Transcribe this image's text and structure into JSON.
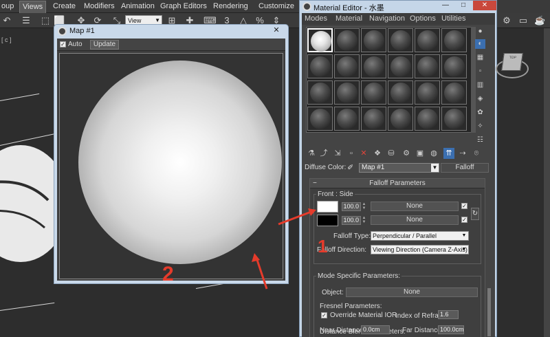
{
  "app": {
    "menu": [
      "oup",
      "Views",
      "Create",
      "Modifiers",
      "Animation",
      "Graph Editors",
      "Rendering",
      "Customize"
    ],
    "view_dropdown": "View",
    "toolbar_number": "3"
  },
  "viewport": {
    "label": "[ c ]"
  },
  "map_window": {
    "title": "Map #1",
    "close": "✕",
    "auto_label": "Auto",
    "auto_checked": "✓",
    "update_label": "Update"
  },
  "material_editor": {
    "title": "Material Editor - 水墨",
    "menus": [
      "Modes",
      "Material",
      "Navigation",
      "Options",
      "Utilities"
    ],
    "diffuse_label": "Diffuse Color:",
    "map_name": "Map #1",
    "map_type": "Falloff",
    "falloff": {
      "header": "Falloff Parameters",
      "front_side_label": "Front : Side",
      "row1": {
        "amount": "100.0",
        "map": "None",
        "swatch_color": "#ffffff"
      },
      "row2": {
        "amount": "100.0",
        "map": "None",
        "swatch_color": "#000000"
      },
      "falloff_type_label": "Falloff Type:",
      "falloff_type_value": "Perpendicular / Parallel",
      "falloff_direction_label": "Falloff Direction:",
      "falloff_direction_value": "Viewing Direction (Camera Z-Axis)"
    },
    "mode_specific": {
      "title": "Mode Specific Parameters:",
      "object_label": "Object:",
      "object_value": "None",
      "fresnel_title": "Fresnel Parameters:",
      "override_label": "Override Material IOR",
      "override_checked": "✓",
      "ior_label": "Index of Refraction",
      "ior_value": "1.6",
      "distance_title": "Distance Blend Parameters:",
      "near_label": "Near Distance:",
      "near_value": "0.0cm",
      "far_label": "Far Distance:",
      "far_value": "100.0cm"
    }
  },
  "annotations": {
    "label1": "1",
    "label2": "2",
    "color": "#e53b2b"
  }
}
